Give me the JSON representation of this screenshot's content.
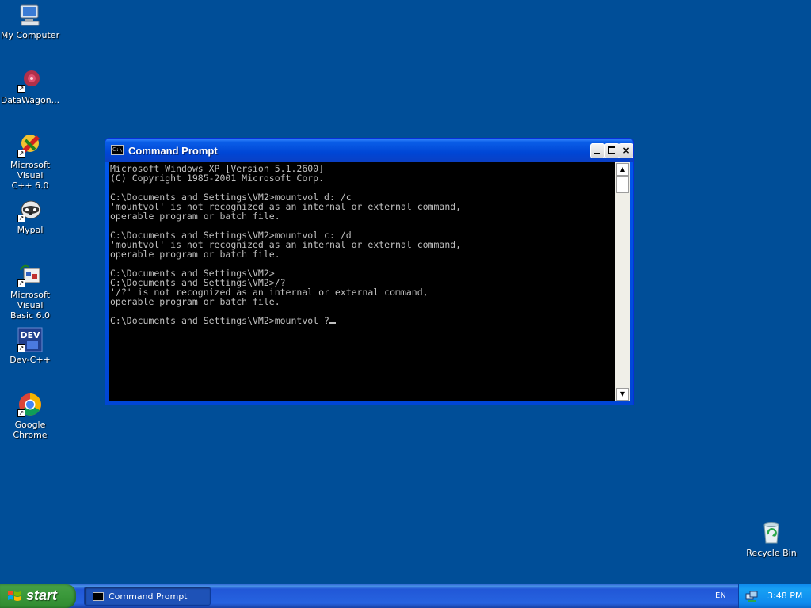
{
  "desktop": {
    "icons": [
      {
        "label": "My Computer",
        "icon": "my-computer-icon"
      },
      {
        "label": "DataWagon...",
        "icon": "datawagon-icon"
      },
      {
        "label": "Microsoft Visual\nC++ 6.0",
        "icon": "visual-cpp-icon"
      },
      {
        "label": "Mypal",
        "icon": "mypal-icon"
      },
      {
        "label": "Microsoft Visual\nBasic 6.0",
        "icon": "visual-basic-icon"
      },
      {
        "label": "Dev-C++",
        "icon": "dev-cpp-icon"
      },
      {
        "label": "Google Chrome",
        "icon": "chrome-icon"
      },
      {
        "label": "Recycle Bin",
        "icon": "recycle-bin-icon"
      }
    ]
  },
  "cmd_window": {
    "title": "Command Prompt",
    "icon_text": "C:\\",
    "lines": [
      "Microsoft Windows XP [Version 5.1.2600]",
      "(C) Copyright 1985-2001 Microsoft Corp.",
      "",
      "C:\\Documents and Settings\\VM2>mountvol d: /c",
      "'mountvol' is not recognized as an internal or external command,",
      "operable program or batch file.",
      "",
      "C:\\Documents and Settings\\VM2>mountvol c: /d",
      "'mountvol' is not recognized as an internal or external command,",
      "operable program or batch file.",
      "",
      "C:\\Documents and Settings\\VM2>",
      "C:\\Documents and Settings\\VM2>/?",
      "'/?' is not recognized as an internal or external command,",
      "operable program or batch file.",
      "",
      "C:\\Documents and Settings\\VM2>mountvol ?"
    ],
    "buttons": {
      "minimize": "minimize",
      "maximize": "maximize",
      "close": "×"
    }
  },
  "taskbar": {
    "start_label": "start",
    "tasks": [
      {
        "label": "Command Prompt"
      }
    ],
    "language": "EN",
    "clock": "3:48 PM"
  },
  "colors": {
    "desktop_bg": "#004e98",
    "console_bg": "#000000",
    "console_fg": "#c0c0c0",
    "titlebar": "#0046d5",
    "start_green": "#3c9a3c"
  }
}
